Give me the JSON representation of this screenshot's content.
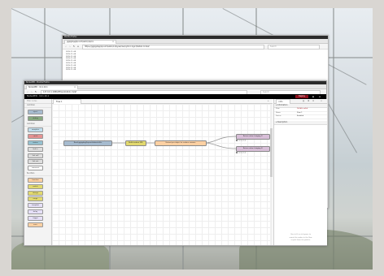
{
  "window1": {
    "titlebar": "Mozilla Firefox",
    "tab_title": "gqjzgdqsj/lqcomh/wbm/n/b/xx",
    "url": "https://gqjzgdqsj/lqcomh/wbm/n/b/yea/mw/nj3m=1/yk?/b2b2c=m2af",
    "search_placeholder": "Search",
    "lines": [
      "2019-11-08",
      "2019-11-08",
      "2019-11-08",
      "2019-11-08",
      "2019-11-08",
      "2019-11-08",
      "2019-11-08",
      "2019-11-08",
      "2019-11-08"
    ]
  },
  "window2": {
    "titlebar": "Node-RED - Mozilla Firefox",
    "tab_title": "Node-RED : 10.1.10.1",
    "url": "127.0.0.1:1880/#flow/1b2b2c.m2af",
    "search_placeholder": "Search",
    "app_name": "Node-RED",
    "host": "10.1.10.1",
    "deploy_label": "Deploy",
    "palette": {
      "filter_placeholder": "filter nodes",
      "categories": [
        {
          "label": "common",
          "nodes": [
            {
              "label": "inject",
              "color": "#a6bbcf"
            },
            {
              "label": "debug",
              "color": "#87a980"
            }
          ]
        },
        {
          "label": "common",
          "nodes": [
            {
              "label": "complete",
              "color": "#c0deed"
            },
            {
              "label": "catch",
              "color": "#e49191"
            },
            {
              "label": "status",
              "color": "#94c1d0"
            },
            {
              "label": "link in",
              "color": "#dddddd"
            },
            {
              "label": "link call",
              "color": "#dddddd"
            },
            {
              "label": "link out",
              "color": "#dddddd"
            },
            {
              "label": "comment",
              "color": "#ffffff"
            }
          ]
        },
        {
          "label": "function",
          "nodes": [
            {
              "label": "function",
              "color": "#fdd0a2"
            },
            {
              "label": "switch",
              "color": "#e2d96e"
            },
            {
              "label": "change",
              "color": "#e2d96e"
            },
            {
              "label": "range",
              "color": "#e2d96e"
            },
            {
              "label": "template",
              "color": "#e6e0f8"
            },
            {
              "label": "delay",
              "color": "#e6e0f8"
            },
            {
              "label": "trigger",
              "color": "#e6e0f8"
            },
            {
              "label": "exec",
              "color": "#fdd0a2"
            }
          ]
        }
      ]
    },
    "workspace": {
      "tab_label": "Flow 1",
      "nodes": [
        {
          "label": "Read gqjzgdqsj/lqcomh/wbm/n/b/x",
          "color": "#a6bbcf"
        },
        {
          "label": "Build ecobee URL",
          "color": "#e2d96e"
        },
        {
          "label": "Extract per object to ecobee sensors",
          "color": "#fdd0a2"
        },
        {
          "label": "Return value (staging 1)",
          "color": "#d8bfd8"
        },
        {
          "label": "Return value (staging 2)",
          "color": "#d8bfd8"
        }
      ],
      "statuses": [
        "connected",
        "connected"
      ]
    },
    "sidebar": {
      "tab_label": "info",
      "section_info": "Information",
      "rows": [
        {
          "k": "Flow",
          "v": "1b2b2c.m2af"
        },
        {
          "k": "Name",
          "v": "Flow 1"
        },
        {
          "k": "Status",
          "v": "Enabled"
        }
      ],
      "section_desc": "Description",
      "help_lines": [
        "Use ctrl-f or ctrl-space to",
        "search for nodes in the flow",
        "or pick from the palette"
      ]
    }
  }
}
